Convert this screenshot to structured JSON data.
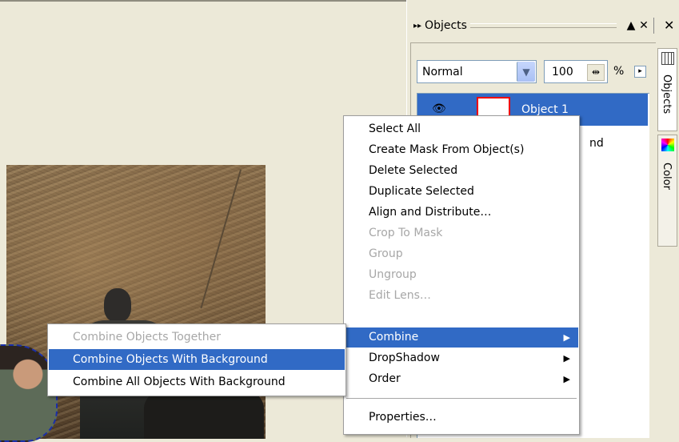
{
  "panel": {
    "title": "Objects",
    "blend_mode": "Normal",
    "opacity": "100",
    "percent": "%",
    "objects": [
      "Object 1",
      "nd"
    ],
    "tabs": [
      "Objects",
      "Color"
    ]
  },
  "context_menu": {
    "items": [
      {
        "label": "Select All",
        "enabled": true
      },
      {
        "label": "Create Mask From Object(s)",
        "enabled": true
      },
      {
        "label": "Delete Selected",
        "enabled": true
      },
      {
        "label": "Duplicate Selected",
        "enabled": true
      },
      {
        "label": "Align and Distribute…",
        "enabled": true
      },
      {
        "label": "Crop To Mask",
        "enabled": false
      },
      {
        "label": "Group",
        "enabled": false
      },
      {
        "label": "Ungroup",
        "enabled": false
      },
      {
        "label": "Edit Lens…",
        "enabled": false
      },
      {
        "label": "Combine",
        "enabled": true,
        "highlighted": true,
        "submenu": true
      },
      {
        "label": "DropShadow",
        "enabled": true,
        "submenu": true
      },
      {
        "label": "Order",
        "enabled": true,
        "submenu": true
      },
      {
        "label": "Properties…",
        "enabled": true
      }
    ]
  },
  "combine_submenu": {
    "items": [
      {
        "label": "Combine Objects Together",
        "enabled": false
      },
      {
        "label": "Combine Objects With Background",
        "enabled": true,
        "highlighted": true
      },
      {
        "label": "Combine All Objects With Background",
        "enabled": true
      }
    ]
  },
  "colors": {
    "highlight": "#316ac5",
    "face": "#ece9d8",
    "disabled_text": "#a7a7a7"
  }
}
